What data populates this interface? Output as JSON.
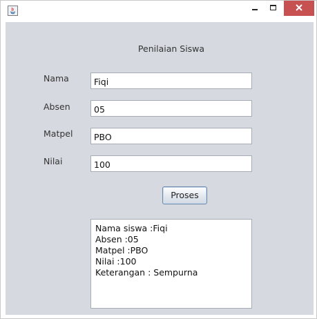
{
  "window": {
    "app_icon": "java-icon",
    "controls": {
      "minimize": "minimize-icon",
      "maximize": "maximize-icon",
      "close": "close-icon"
    }
  },
  "form": {
    "title": "Penilaian Siswa",
    "fields": [
      {
        "label": "Nama",
        "value": "Fiqi"
      },
      {
        "label": "Absen",
        "value": "05"
      },
      {
        "label": "Matpel",
        "value": "PBO"
      },
      {
        "label": "Nilai",
        "value": "100"
      }
    ],
    "button_label": "Proses",
    "output_lines": [
      "Nama siswa :Fiqi",
      "Absen :05",
      "Matpel :PBO",
      "Nilai :100",
      "Keterangan : Sempurna"
    ]
  },
  "colors": {
    "panel_bg": "#d6d9df",
    "close_button": "#c75050"
  }
}
